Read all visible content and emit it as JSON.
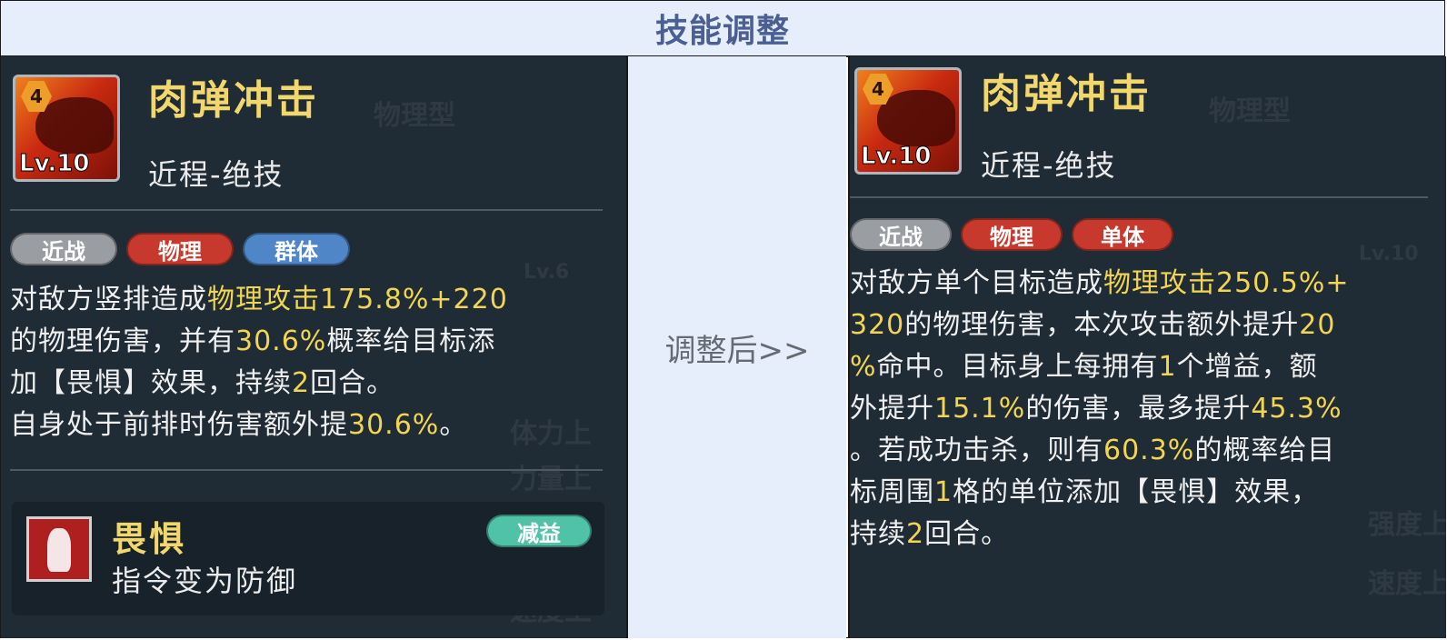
{
  "header": {
    "title": "技能调整"
  },
  "middle": {
    "arrow_text": "调整后>>"
  },
  "left": {
    "skill": {
      "level_badge": "4",
      "level": "Lv.10",
      "name": "肉弹冲击",
      "type": "近程-绝技",
      "icon": "beast-charge-icon"
    },
    "tags": [
      "近战",
      "物理",
      "群体"
    ],
    "description": [
      [
        {
          "t": "对敌方竖排造成"
        },
        {
          "t": "物理攻击175.8%+220",
          "hl": true
        }
      ],
      [
        {
          "t": "的物理伤害，并有"
        },
        {
          "t": "30.6%",
          "hl": true
        },
        {
          "t": "概率给目标添"
        }
      ],
      [
        {
          "t": "加【畏惧】效果，持续"
        },
        {
          "t": "2",
          "hl": true
        },
        {
          "t": "回合。"
        }
      ],
      [
        {
          "t": "自身处于前排时伤害额外提"
        },
        {
          "t": "30.6%",
          "hl": true
        },
        {
          "t": "。"
        }
      ]
    ],
    "buff": {
      "name": "畏惧",
      "desc": "指令变为防御",
      "tag": "减益",
      "icon": "fear-figure-icon"
    },
    "watermarks": [
      "物理型",
      "体力上",
      "力量上",
      "速度上",
      "Lv.6"
    ]
  },
  "right": {
    "skill": {
      "level_badge": "4",
      "level": "Lv.10",
      "name": "肉弹冲击",
      "type": "近程-绝技",
      "icon": "beast-charge-icon"
    },
    "tags": [
      "近战",
      "物理",
      "单体"
    ],
    "description": [
      [
        {
          "t": "对敌方单个目标造成"
        },
        {
          "t": "物理攻击250.5%+",
          "hl": true
        }
      ],
      [
        {
          "t": "320",
          "hl": true
        },
        {
          "t": "的物理伤害，本次攻击额外提升"
        },
        {
          "t": "20",
          "hl": true
        }
      ],
      [
        {
          "t": "%",
          "hl": true
        },
        {
          "t": "命中。目标身上每拥有"
        },
        {
          "t": "1",
          "hl": true
        },
        {
          "t": "个增益，额"
        }
      ],
      [
        {
          "t": "外提升"
        },
        {
          "t": "15.1%",
          "hl": true
        },
        {
          "t": "的伤害，最多提升"
        },
        {
          "t": "45.3%",
          "hl": true
        }
      ],
      [
        {
          "t": "。若成功击杀，则有"
        },
        {
          "t": "60.3%",
          "hl": true
        },
        {
          "t": "的概率给目"
        }
      ],
      [
        {
          "t": "标周围"
        },
        {
          "t": "1",
          "hl": true
        },
        {
          "t": "格的单位添加【畏惧】效果，"
        }
      ],
      [
        {
          "t": "持续"
        },
        {
          "t": "2",
          "hl": true
        },
        {
          "t": "回合。"
        }
      ]
    ],
    "watermarks": [
      "物理型",
      "强度上",
      "速度上",
      "Lv.10"
    ]
  },
  "colors": {
    "highlight": "#f2d552",
    "panel_bg": "#1f2b35",
    "header_bg": "#e6eefb",
    "title_color": "#4a5f93"
  }
}
